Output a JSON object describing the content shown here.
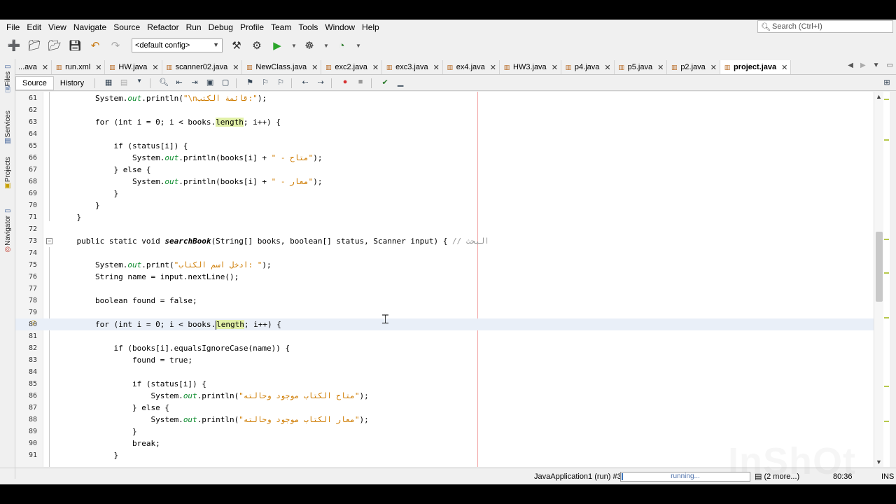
{
  "menu": [
    "File",
    "Edit",
    "View",
    "Navigate",
    "Source",
    "Refactor",
    "Run",
    "Debug",
    "Profile",
    "Team",
    "Tools",
    "Window",
    "Help"
  ],
  "search": {
    "placeholder": "Search (Ctrl+I)"
  },
  "toolbar": {
    "config": "<default config>"
  },
  "side_panels": [
    "Files",
    "Services",
    "Projects",
    "Navigator"
  ],
  "tabs": [
    {
      "label": "...ava",
      "active": false
    },
    {
      "label": "run.xml",
      "active": false
    },
    {
      "label": "HW.java",
      "active": false
    },
    {
      "label": "scanner02.java",
      "active": false
    },
    {
      "label": "NewClass.java",
      "active": false
    },
    {
      "label": "exc2.java",
      "active": false
    },
    {
      "label": "exc3.java",
      "active": false
    },
    {
      "label": "ex4.java",
      "active": false
    },
    {
      "label": "HW3.java",
      "active": false
    },
    {
      "label": "p4.java",
      "active": false
    },
    {
      "label": "p5.java",
      "active": false
    },
    {
      "label": "p2.java",
      "active": false
    },
    {
      "label": "project.java",
      "active": true
    }
  ],
  "editor_toolbar": {
    "source": "Source",
    "history": "History"
  },
  "code_lines": [
    {
      "n": "61",
      "indent": 8,
      "text": "System.out.println(\"\\nقائمة الكتب:\");"
    },
    {
      "n": "62",
      "indent": 0,
      "text": ""
    },
    {
      "n": "63",
      "indent": 8,
      "text": "for (int i = 0; i < books.length; i++) {"
    },
    {
      "n": "64",
      "indent": 0,
      "text": ""
    },
    {
      "n": "65",
      "indent": 12,
      "text": "if (status[i]) {"
    },
    {
      "n": "66",
      "indent": 16,
      "text": "System.out.println(books[i] + \" - متاح\");"
    },
    {
      "n": "67",
      "indent": 12,
      "text": "} else {"
    },
    {
      "n": "68",
      "indent": 16,
      "text": "System.out.println(books[i] + \" - معار\");"
    },
    {
      "n": "69",
      "indent": 12,
      "text": "}"
    },
    {
      "n": "70",
      "indent": 8,
      "text": "}"
    },
    {
      "n": "71",
      "indent": 4,
      "text": "}"
    },
    {
      "n": "72",
      "indent": 0,
      "text": ""
    },
    {
      "n": "73",
      "indent": 4,
      "text": "public static void searchBook(String[] books, boolean[] status, Scanner input) { // البحث"
    },
    {
      "n": "74",
      "indent": 0,
      "text": ""
    },
    {
      "n": "75",
      "indent": 8,
      "text": "System.out.print(\"ادخل اسم الكتاب: \");"
    },
    {
      "n": "76",
      "indent": 8,
      "text": "String name = input.nextLine();"
    },
    {
      "n": "77",
      "indent": 0,
      "text": ""
    },
    {
      "n": "78",
      "indent": 8,
      "text": "boolean found = false;"
    },
    {
      "n": "79",
      "indent": 0,
      "text": ""
    },
    {
      "n": "80",
      "indent": 8,
      "text": "for (int i = 0; i < books.length; i++) {"
    },
    {
      "n": "81",
      "indent": 0,
      "text": ""
    },
    {
      "n": "82",
      "indent": 12,
      "text": "if (books[i].equalsIgnoreCase(name)) {"
    },
    {
      "n": "83",
      "indent": 16,
      "text": "found = true;"
    },
    {
      "n": "84",
      "indent": 0,
      "text": ""
    },
    {
      "n": "85",
      "indent": 16,
      "text": "if (status[i]) {"
    },
    {
      "n": "86",
      "indent": 20,
      "text": "System.out.println(\"متاح الكتاب موجود وحالته\");"
    },
    {
      "n": "87",
      "indent": 16,
      "text": "} else {"
    },
    {
      "n": "88",
      "indent": 20,
      "text": "System.out.println(\"معار الكتاب موجود وحالته\");"
    },
    {
      "n": "89",
      "indent": 16,
      "text": "}"
    },
    {
      "n": "90",
      "indent": 16,
      "text": "break;"
    },
    {
      "n": "91",
      "indent": 12,
      "text": "}"
    }
  ],
  "status": {
    "process": "JavaApplication1 (run) #3",
    "progress_text": "running...",
    "more": "(2 more...)",
    "position": "80:36",
    "mode": "INS"
  },
  "watermark": "InShOt",
  "colors": {
    "string": "#ce7b00",
    "static_field": "#0b8b2c",
    "highlight": "#e2f1a8",
    "current_line": "#e9eff8",
    "margin": "#f2a3a3"
  }
}
